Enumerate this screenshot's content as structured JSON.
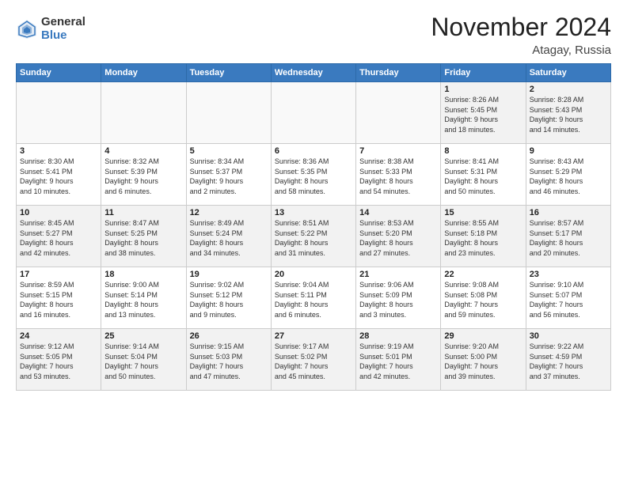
{
  "logo": {
    "general": "General",
    "blue": "Blue"
  },
  "title": "November 2024",
  "location": "Atagay, Russia",
  "days_header": [
    "Sunday",
    "Monday",
    "Tuesday",
    "Wednesday",
    "Thursday",
    "Friday",
    "Saturday"
  ],
  "weeks": [
    [
      {
        "day": "",
        "info": ""
      },
      {
        "day": "",
        "info": ""
      },
      {
        "day": "",
        "info": ""
      },
      {
        "day": "",
        "info": ""
      },
      {
        "day": "",
        "info": ""
      },
      {
        "day": "1",
        "info": "Sunrise: 8:26 AM\nSunset: 5:45 PM\nDaylight: 9 hours\nand 18 minutes."
      },
      {
        "day": "2",
        "info": "Sunrise: 8:28 AM\nSunset: 5:43 PM\nDaylight: 9 hours\nand 14 minutes."
      }
    ],
    [
      {
        "day": "3",
        "info": "Sunrise: 8:30 AM\nSunset: 5:41 PM\nDaylight: 9 hours\nand 10 minutes."
      },
      {
        "day": "4",
        "info": "Sunrise: 8:32 AM\nSunset: 5:39 PM\nDaylight: 9 hours\nand 6 minutes."
      },
      {
        "day": "5",
        "info": "Sunrise: 8:34 AM\nSunset: 5:37 PM\nDaylight: 9 hours\nand 2 minutes."
      },
      {
        "day": "6",
        "info": "Sunrise: 8:36 AM\nSunset: 5:35 PM\nDaylight: 8 hours\nand 58 minutes."
      },
      {
        "day": "7",
        "info": "Sunrise: 8:38 AM\nSunset: 5:33 PM\nDaylight: 8 hours\nand 54 minutes."
      },
      {
        "day": "8",
        "info": "Sunrise: 8:41 AM\nSunset: 5:31 PM\nDaylight: 8 hours\nand 50 minutes."
      },
      {
        "day": "9",
        "info": "Sunrise: 8:43 AM\nSunset: 5:29 PM\nDaylight: 8 hours\nand 46 minutes."
      }
    ],
    [
      {
        "day": "10",
        "info": "Sunrise: 8:45 AM\nSunset: 5:27 PM\nDaylight: 8 hours\nand 42 minutes."
      },
      {
        "day": "11",
        "info": "Sunrise: 8:47 AM\nSunset: 5:25 PM\nDaylight: 8 hours\nand 38 minutes."
      },
      {
        "day": "12",
        "info": "Sunrise: 8:49 AM\nSunset: 5:24 PM\nDaylight: 8 hours\nand 34 minutes."
      },
      {
        "day": "13",
        "info": "Sunrise: 8:51 AM\nSunset: 5:22 PM\nDaylight: 8 hours\nand 31 minutes."
      },
      {
        "day": "14",
        "info": "Sunrise: 8:53 AM\nSunset: 5:20 PM\nDaylight: 8 hours\nand 27 minutes."
      },
      {
        "day": "15",
        "info": "Sunrise: 8:55 AM\nSunset: 5:18 PM\nDaylight: 8 hours\nand 23 minutes."
      },
      {
        "day": "16",
        "info": "Sunrise: 8:57 AM\nSunset: 5:17 PM\nDaylight: 8 hours\nand 20 minutes."
      }
    ],
    [
      {
        "day": "17",
        "info": "Sunrise: 8:59 AM\nSunset: 5:15 PM\nDaylight: 8 hours\nand 16 minutes."
      },
      {
        "day": "18",
        "info": "Sunrise: 9:00 AM\nSunset: 5:14 PM\nDaylight: 8 hours\nand 13 minutes."
      },
      {
        "day": "19",
        "info": "Sunrise: 9:02 AM\nSunset: 5:12 PM\nDaylight: 8 hours\nand 9 minutes."
      },
      {
        "day": "20",
        "info": "Sunrise: 9:04 AM\nSunset: 5:11 PM\nDaylight: 8 hours\nand 6 minutes."
      },
      {
        "day": "21",
        "info": "Sunrise: 9:06 AM\nSunset: 5:09 PM\nDaylight: 8 hours\nand 3 minutes."
      },
      {
        "day": "22",
        "info": "Sunrise: 9:08 AM\nSunset: 5:08 PM\nDaylight: 7 hours\nand 59 minutes."
      },
      {
        "day": "23",
        "info": "Sunrise: 9:10 AM\nSunset: 5:07 PM\nDaylight: 7 hours\nand 56 minutes."
      }
    ],
    [
      {
        "day": "24",
        "info": "Sunrise: 9:12 AM\nSunset: 5:05 PM\nDaylight: 7 hours\nand 53 minutes."
      },
      {
        "day": "25",
        "info": "Sunrise: 9:14 AM\nSunset: 5:04 PM\nDaylight: 7 hours\nand 50 minutes."
      },
      {
        "day": "26",
        "info": "Sunrise: 9:15 AM\nSunset: 5:03 PM\nDaylight: 7 hours\nand 47 minutes."
      },
      {
        "day": "27",
        "info": "Sunrise: 9:17 AM\nSunset: 5:02 PM\nDaylight: 7 hours\nand 45 minutes."
      },
      {
        "day": "28",
        "info": "Sunrise: 9:19 AM\nSunset: 5:01 PM\nDaylight: 7 hours\nand 42 minutes."
      },
      {
        "day": "29",
        "info": "Sunrise: 9:20 AM\nSunset: 5:00 PM\nDaylight: 7 hours\nand 39 minutes."
      },
      {
        "day": "30",
        "info": "Sunrise: 9:22 AM\nSunset: 4:59 PM\nDaylight: 7 hours\nand 37 minutes."
      }
    ]
  ]
}
